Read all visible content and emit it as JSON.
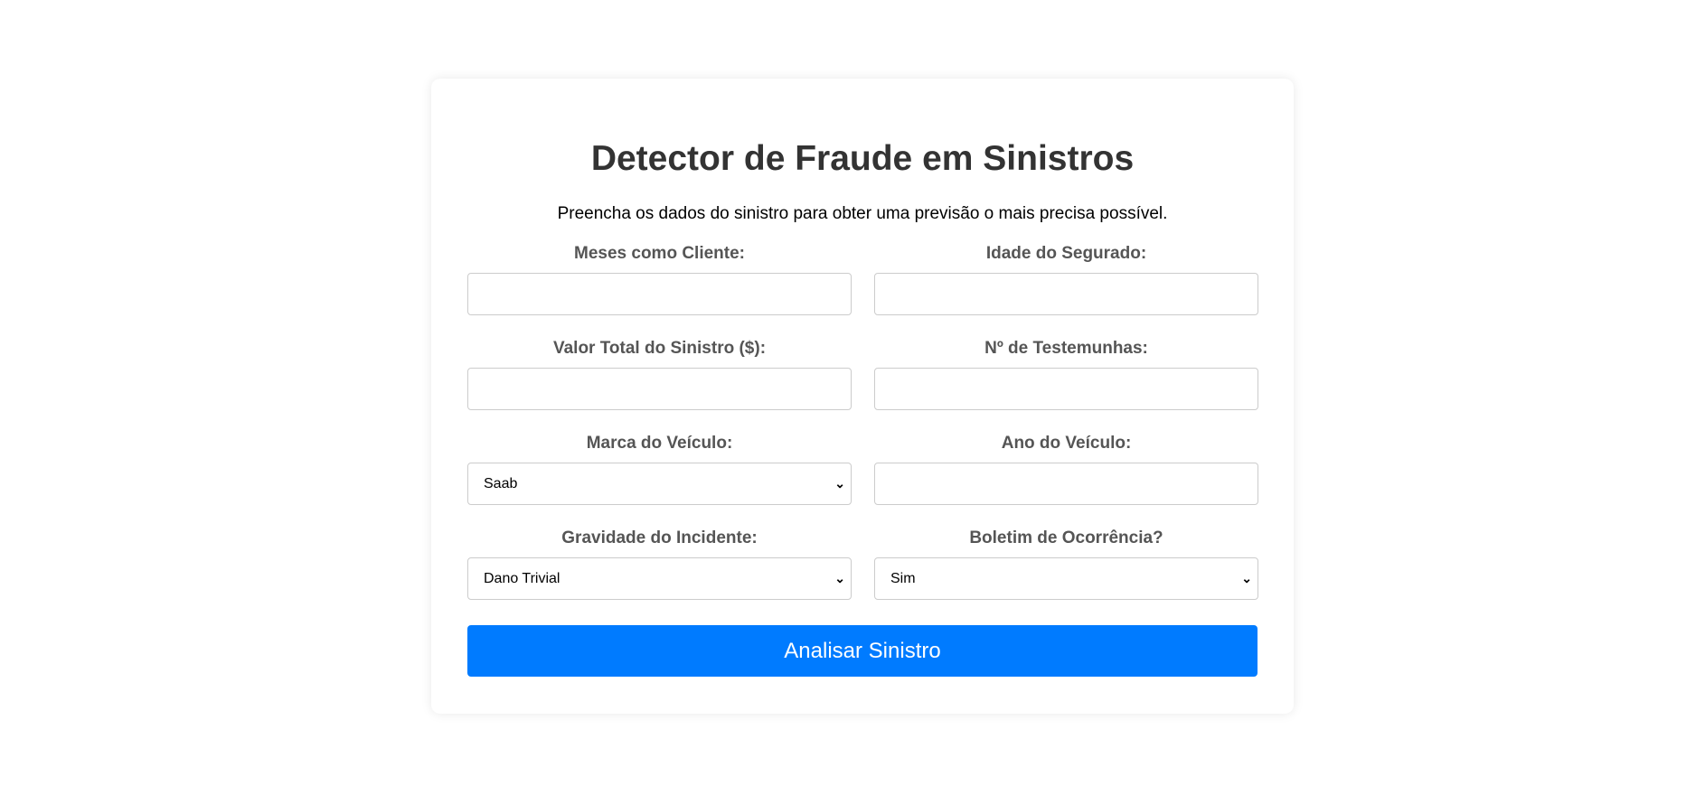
{
  "title": "Detector de Fraude em Sinistros",
  "subtitle": "Preencha os dados do sinistro para obter uma previsão o mais precisa possível.",
  "fields": [
    {
      "label": "Meses como Cliente:",
      "type": "input",
      "value": ""
    },
    {
      "label": "Idade do Segurado:",
      "type": "input",
      "value": ""
    },
    {
      "label": "Valor Total do Sinistro ($):",
      "type": "input",
      "value": ""
    },
    {
      "label": "Nº de Testemunhas:",
      "type": "input",
      "value": ""
    },
    {
      "label": "Marca do Veículo:",
      "type": "select",
      "value": "Saab"
    },
    {
      "label": "Ano do Veículo:",
      "type": "input",
      "value": ""
    },
    {
      "label": "Gravidade do Incidente:",
      "type": "select",
      "value": "Dano Trivial"
    },
    {
      "label": "Boletim de Ocorrência?",
      "type": "select",
      "value": "Sim"
    }
  ],
  "submit_label": "Analisar Sinistro",
  "colors": {
    "accent": "#007bff",
    "title": "#333333",
    "label": "#555555"
  },
  "icons": {
    "select_arrow": "chevron-down-icon"
  }
}
